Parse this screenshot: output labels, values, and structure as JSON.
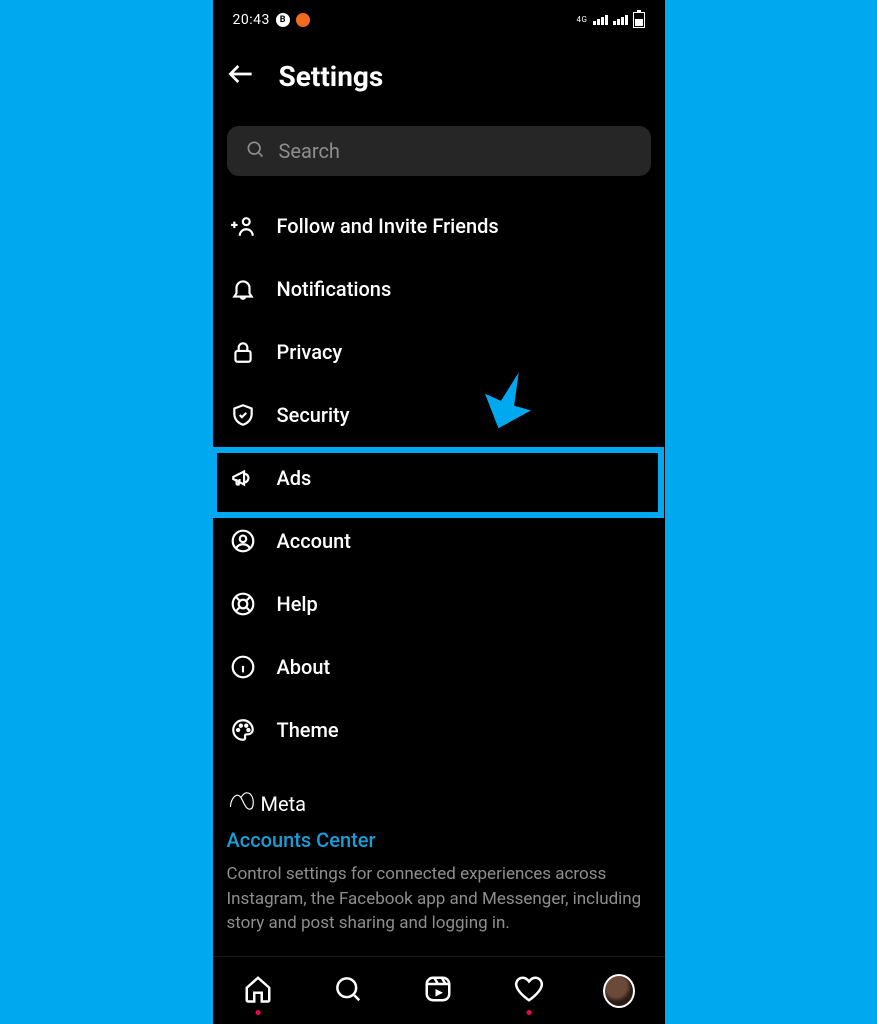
{
  "status": {
    "time": "20:43",
    "badge_b": "B",
    "network_label": "4G"
  },
  "header": {
    "title": "Settings"
  },
  "search": {
    "placeholder": "Search"
  },
  "items": [
    {
      "label": "Follow and Invite Friends",
      "icon": "add-user-icon"
    },
    {
      "label": "Notifications",
      "icon": "bell-icon"
    },
    {
      "label": "Privacy",
      "icon": "lock-icon"
    },
    {
      "label": "Security",
      "icon": "shield-check-icon"
    },
    {
      "label": "Ads",
      "icon": "megaphone-icon"
    },
    {
      "label": "Account",
      "icon": "user-circle-icon"
    },
    {
      "label": "Help",
      "icon": "lifebuoy-icon"
    },
    {
      "label": "About",
      "icon": "info-icon"
    },
    {
      "label": "Theme",
      "icon": "palette-icon"
    }
  ],
  "highlighted_item_index": 3,
  "meta": {
    "brand": "Meta",
    "link": "Accounts Center",
    "description": "Control settings for connected experiences across Instagram, the Facebook app and Messenger, including story and post sharing and logging in."
  },
  "colors": {
    "background_outer": "#00a8f0",
    "highlight_border": "#00a8f0",
    "link": "#179ed9"
  }
}
